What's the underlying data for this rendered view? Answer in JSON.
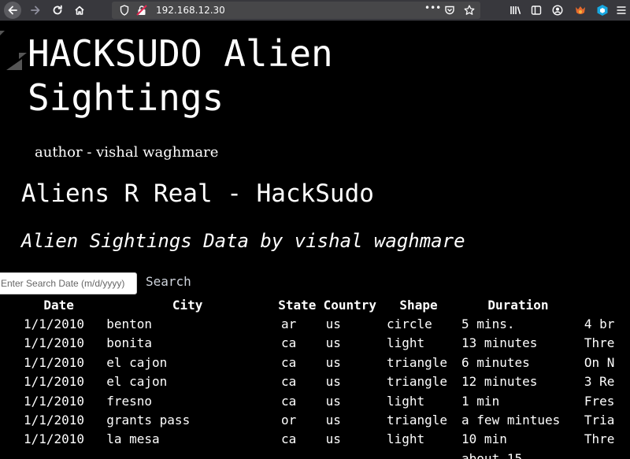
{
  "browser": {
    "url": "192.168.12.30",
    "page_actions_label": "•••"
  },
  "page": {
    "title": "HACKSUDO Alien Sightings",
    "author": "author - vishal waghmare",
    "heading": "Aliens R Real - HackSudo",
    "subheading": "Alien Sightings Data by vishal waghmare"
  },
  "search": {
    "placeholder": "Enter Search Date (m/d/yyyy)",
    "value": "",
    "button_label": "Search"
  },
  "table": {
    "headers": [
      "Date",
      "City",
      "State",
      "Country",
      "Shape",
      "Duration",
      ""
    ],
    "rows": [
      [
        "1/1/2010",
        "benton",
        "ar",
        "us",
        "circle",
        "5 mins.",
        "4 br"
      ],
      [
        "1/1/2010",
        "bonita",
        "ca",
        "us",
        "light",
        "13 minutes",
        "Thre"
      ],
      [
        "1/1/2010",
        "el cajon",
        "ca",
        "us",
        "triangle",
        "6 minutes",
        "On N"
      ],
      [
        "1/1/2010",
        "el cajon",
        "ca",
        "us",
        "triangle",
        "12 minutes",
        "3 Re"
      ],
      [
        "1/1/2010",
        "fresno",
        "ca",
        "us",
        "light",
        "1 min",
        "Fres"
      ],
      [
        "1/1/2010",
        "grants pass",
        "or",
        "us",
        "triangle",
        "a few mintues",
        "Tria"
      ],
      [
        "1/1/2010",
        "la mesa",
        "ca",
        "us",
        "light",
        "10 min",
        "Thre"
      ],
      [
        "",
        "",
        "",
        "",
        "",
        "about 15",
        ""
      ]
    ]
  },
  "colors": {
    "chrome_bg": "#38383d",
    "urlbar_bg": "#474749",
    "page_bg": "#000000",
    "text": "#ffffff",
    "search_link": "#cfd4dc"
  }
}
